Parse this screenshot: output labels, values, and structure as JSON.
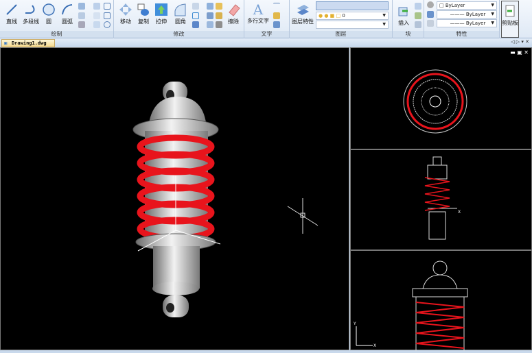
{
  "ribbon": {
    "draw": {
      "title": "绘制",
      "line": "直线",
      "polyline": "多段线",
      "circle": "圆",
      "arc": "圆弧"
    },
    "modify": {
      "title": "修改",
      "move": "移动",
      "copy": "复制",
      "stretch": "拉伸",
      "fillet": "圆角",
      "erase": "擦除"
    },
    "text": {
      "title": "文字",
      "mtext": "多行文字"
    },
    "layers": {
      "title": "图层",
      "properties": "图层特性",
      "current_layer": "0"
    },
    "block": {
      "title": "块",
      "insert": "插入"
    },
    "props": {
      "title": "特性",
      "color": "ByLayer",
      "linetype": "ByLayer",
      "lineweight": "ByLayer"
    },
    "clipboard": {
      "label": "剪贴板"
    }
  },
  "tabs": {
    "document": "Drawing1.dwg",
    "controls": "◁ ▷ ▾ ✕"
  },
  "viewport": {
    "x_label": "X",
    "y_label": "Y"
  },
  "colors": {
    "spring": "#e8141c",
    "background": "#000000",
    "ribbon": "#dfe9f5"
  }
}
